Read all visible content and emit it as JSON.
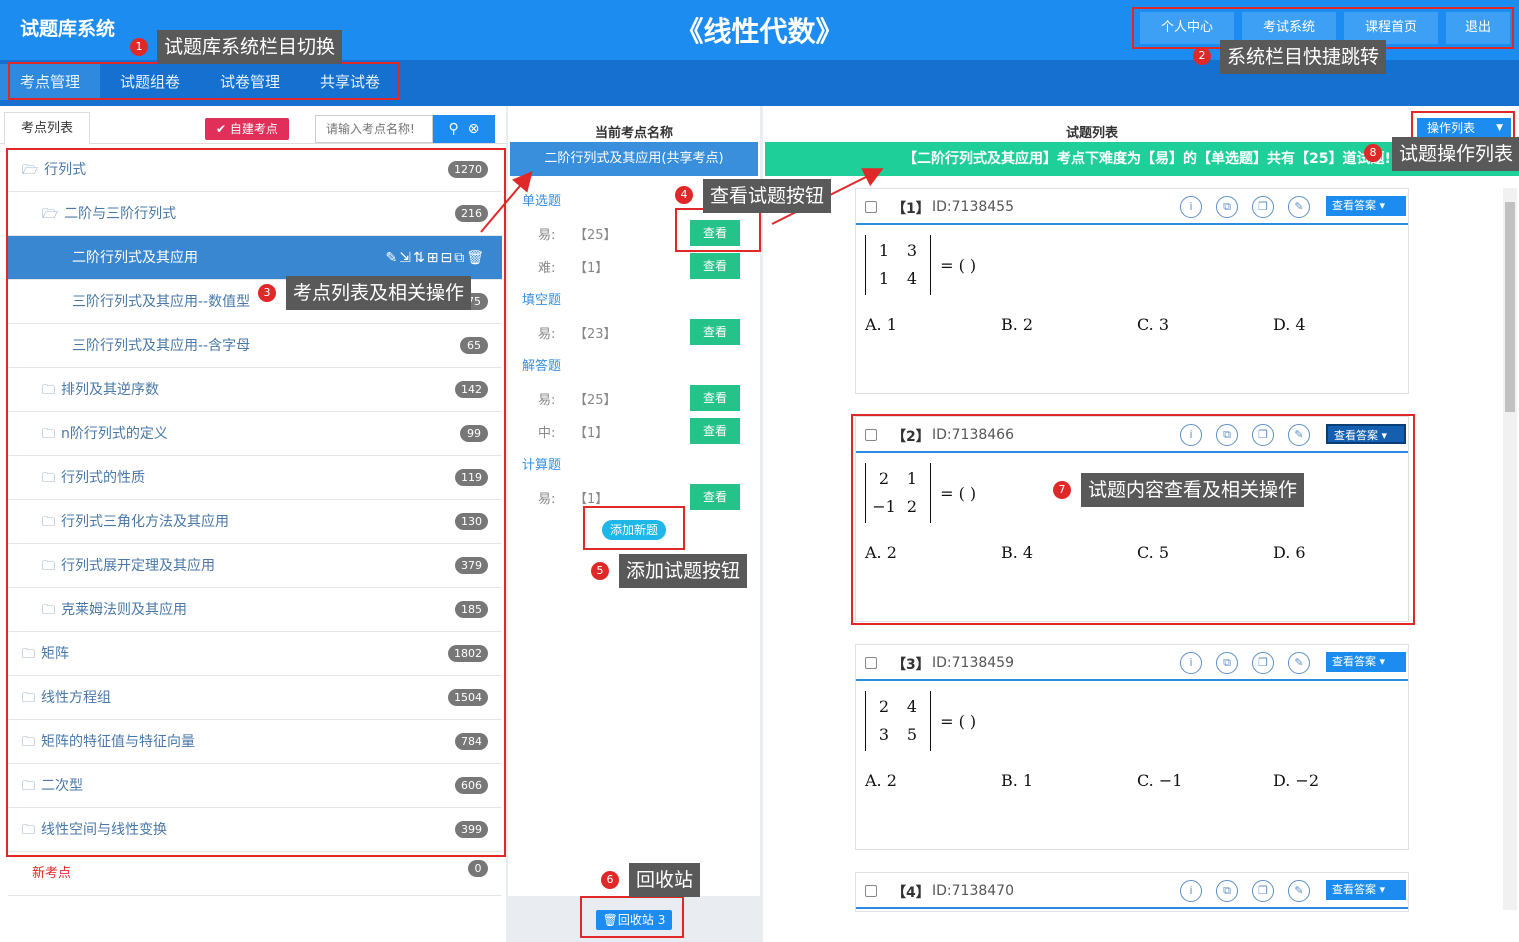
{
  "header": {
    "app_title": "试题库系统",
    "course_title": "《线性代数》",
    "top_buttons": [
      "个人中心",
      "考试系统",
      "课程首页",
      "退出"
    ],
    "nav_tabs": [
      "考点管理",
      "试题组卷",
      "试卷管理",
      "共享试卷"
    ]
  },
  "annotations": {
    "c1": "试题库系统栏目切换",
    "c2": "系统栏目快捷跳转",
    "c3": "考点列表及相关操作",
    "c4": "查看试题按钮",
    "c5": "添加试题按钮",
    "c6": "回收站",
    "c7": "试题内容查看及相关操作",
    "c8": "试题操作列表",
    "n1": "1",
    "n2": "2",
    "n3": "3",
    "n4": "4",
    "n5": "5",
    "n6": "6",
    "n7": "7",
    "n8": "8"
  },
  "left": {
    "tab": "考点列表",
    "new_button": "自建考点",
    "search_placeholder": "请输入考点名称!",
    "tree": [
      {
        "label": "行列式",
        "count": "1270"
      },
      {
        "label": "二阶与三阶行列式",
        "count": "216"
      },
      {
        "label": "二阶行列式及其应用",
        "count": ""
      },
      {
        "label": "三阶行列式及其应用--数值型",
        "count": "75"
      },
      {
        "label": "三阶行列式及其应用--含字母",
        "count": "65"
      },
      {
        "label": "排列及其逆序数",
        "count": "142"
      },
      {
        "label": "n阶行列式的定义",
        "count": "99"
      },
      {
        "label": "行列式的性质",
        "count": "119"
      },
      {
        "label": "行列式三角化方法及其应用",
        "count": "130"
      },
      {
        "label": "行列式展开定理及其应用",
        "count": "379"
      },
      {
        "label": "克莱姆法则及其应用",
        "count": "185"
      },
      {
        "label": "矩阵",
        "count": "1802"
      },
      {
        "label": "线性方程组",
        "count": "1504"
      },
      {
        "label": "矩阵的特征值与特征向量",
        "count": "784"
      },
      {
        "label": "二次型",
        "count": "606"
      },
      {
        "label": "线性空间与线性变换",
        "count": "399"
      },
      {
        "label": "新考点",
        "count": "0"
      }
    ]
  },
  "middle": {
    "header": "当前考点名称",
    "point_name": "二阶行列式及其应用(共享考点)",
    "types": {
      "t1": "单选题",
      "t2": "填空题",
      "t3": "解答题",
      "t4": "计算题"
    },
    "rows": [
      {
        "diff": "易:",
        "count": "【25】"
      },
      {
        "diff": "难:",
        "count": "【1】"
      },
      {
        "diff": "易:",
        "count": "【23】"
      },
      {
        "diff": "易:",
        "count": "【25】"
      },
      {
        "diff": "中:",
        "count": "【1】"
      },
      {
        "diff": "易:",
        "count": "【1】"
      }
    ],
    "view_label": "查看",
    "add_label": "添加新题",
    "recycle_label": "回收站 3"
  },
  "right": {
    "header": "试题列表",
    "op_list_label": "操作列表",
    "banner": "【二阶行列式及其应用】考点下难度为【易】的【单选题】共有【25】道试题!",
    "answer_label": "查看答案",
    "questions": [
      {
        "no": "【1】",
        "id": "ID:7138455",
        "m": [
          "1",
          "3",
          "1",
          "4"
        ],
        "eq": "= (   )",
        "opts": [
          "A. 1",
          "B. 2",
          "C. 3",
          "D. 4"
        ]
      },
      {
        "no": "【2】",
        "id": "ID:7138466",
        "m": [
          "2",
          "1",
          "−1",
          "2"
        ],
        "eq": "= (   )",
        "opts": [
          "A. 2",
          "B. 4",
          "C. 5",
          "D. 6"
        ]
      },
      {
        "no": "【3】",
        "id": "ID:7138459",
        "m": [
          "2",
          "4",
          "3",
          "5"
        ],
        "eq": "= (   )",
        "opts": [
          "A. 2",
          "B. 1",
          "C. −1",
          "D. −2"
        ]
      },
      {
        "no": "【4】",
        "id": "ID:7138470"
      }
    ]
  },
  "icons": {
    "folder": "folder-open-icon",
    "search": "search-icon",
    "clear": "close-icon",
    "info": "info-icon",
    "copy": "copy-icon",
    "edit": "edit-icon",
    "trash": "trash-icon",
    "chevron": "chevron-down-icon"
  }
}
